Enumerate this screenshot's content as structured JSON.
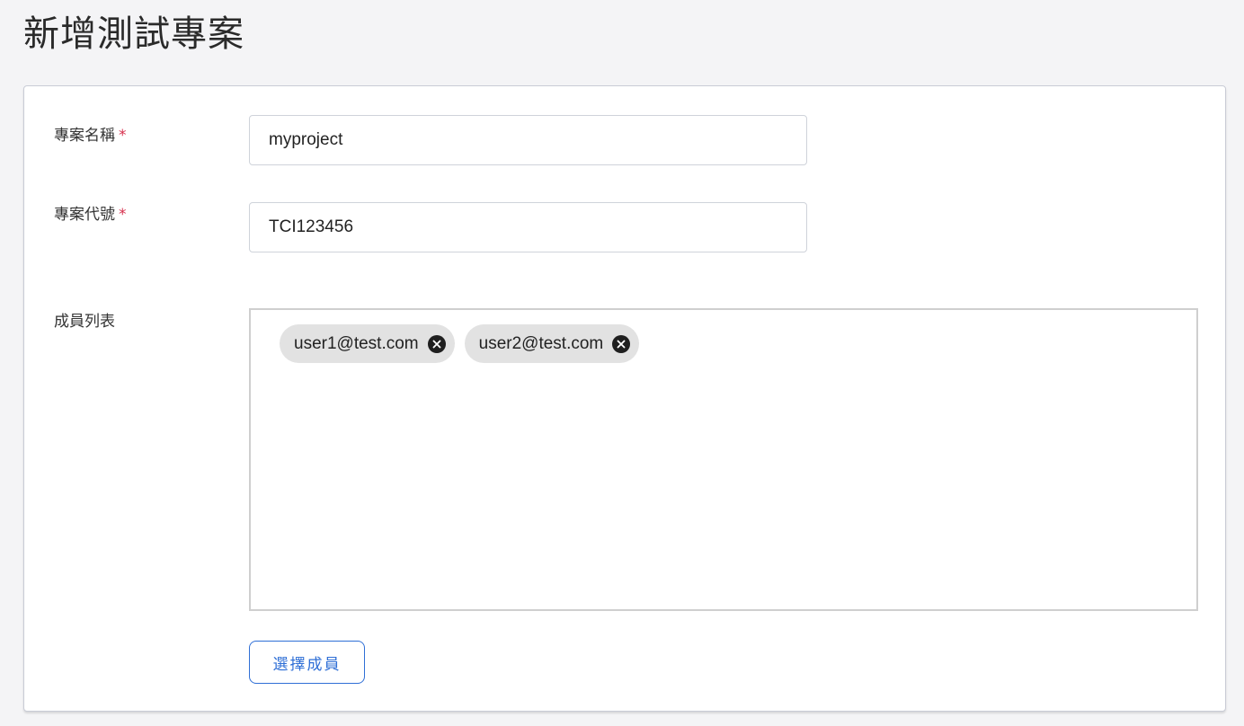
{
  "page": {
    "title": "新增測試專案"
  },
  "form": {
    "project_name": {
      "label": "專案名稱",
      "required_mark": "*",
      "value": "myproject"
    },
    "project_code": {
      "label": "專案代號",
      "required_mark": "*",
      "value": "TCI123456"
    },
    "members": {
      "label": "成員列表",
      "chips": [
        {
          "email": "user1@test.com",
          "remove_icon": "close-circle-icon"
        },
        {
          "email": "user2@test.com",
          "remove_icon": "close-circle-icon"
        }
      ]
    },
    "select_members_button": "選擇成員"
  },
  "colors": {
    "background": "#f4f4f6",
    "required": "#d6304d",
    "accent": "#2f6fd6",
    "chip_bg": "#e2e2e2"
  }
}
